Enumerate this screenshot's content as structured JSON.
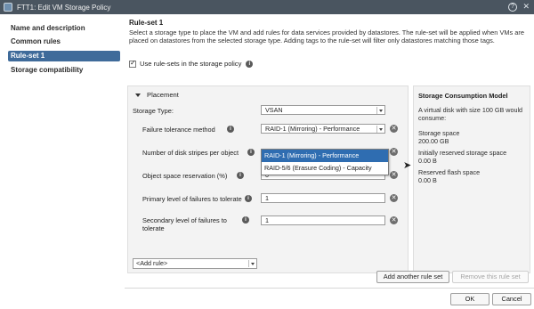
{
  "window": {
    "title": "FTT1: Edit VM Storage Policy",
    "help_icon": "help-icon",
    "close_icon": "close-icon"
  },
  "sidebar": {
    "items": [
      {
        "label": "Name and description"
      },
      {
        "label": "Common rules"
      },
      {
        "label": "Rule-set 1",
        "active": true
      },
      {
        "label": "Storage compatibility"
      }
    ]
  },
  "main": {
    "title": "Rule-set 1",
    "description": "Select a storage type to place the VM and add rules for data services provided by datastores. The rule-set will be applied when VMs are placed on datastores from the selected storage type. Adding tags to the rule-set will filter only datastores matching those tags.",
    "use_rulesets_label": "Use rule-sets in the storage policy",
    "use_rulesets_checked": true
  },
  "placement": {
    "header": "Placement",
    "storage_type_label": "Storage Type:",
    "storage_type_value": "VSAN",
    "rules": {
      "failure_tolerance": {
        "label": "Failure tolerance method",
        "value": "RAID-1 (Mirroring) - Performance"
      },
      "disk_stripes": {
        "label": "Number of disk stripes per object"
      },
      "space_reservation": {
        "label": "Object space reservation (%)",
        "value": "0"
      },
      "primary_failures": {
        "label": "Primary level of failures to tolerate",
        "value": "1"
      },
      "secondary_failures": {
        "label": "Secondary level of failures to tolerate",
        "value": "1"
      }
    },
    "dropdown_options": [
      {
        "label": "RAID-1 (Mirroring) - Performance",
        "selected": true
      },
      {
        "label": "RAID-5/6 (Erasure Coding) - Capacity",
        "selected": false
      }
    ],
    "add_rule_label": "<Add rule>"
  },
  "consumption": {
    "title": "Storage Consumption Model",
    "intro": "A virtual disk with size 100 GB would consume:",
    "storage_space_label": "Storage space",
    "storage_space_value": "200.00 GB",
    "reserved_storage_label": "Initially reserved storage space",
    "reserved_storage_value": "0.00 B",
    "reserved_flash_label": "Reserved flash space",
    "reserved_flash_value": "0.00 B"
  },
  "buttons": {
    "add_ruleset": "Add another rule set",
    "remove_ruleset": "Remove this rule set",
    "ok": "OK",
    "cancel": "Cancel"
  },
  "colors": {
    "titlebar": "#4a5560",
    "accent": "#3f6b9a",
    "selection": "#2f6db1"
  }
}
